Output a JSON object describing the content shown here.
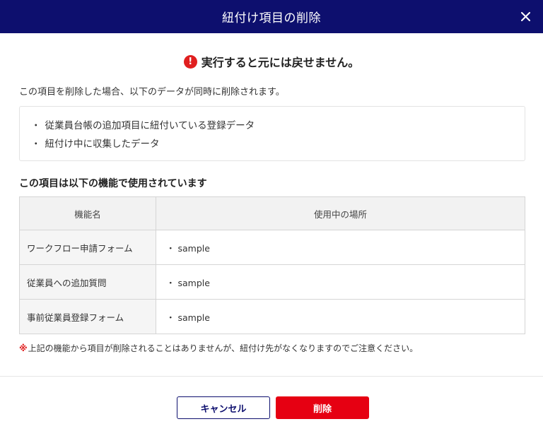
{
  "dialog": {
    "title": "紐付け項目の削除",
    "warning_icon": "!",
    "warning_text": "実行すると元には戻せません。",
    "description": "この項目を削除した場合、以下のデータが同時に削除されます。",
    "bullet": "・",
    "deleted_items": [
      "従業員台帳の追加項目に紐付いている登録データ",
      "紐付け中に収集したデータ"
    ],
    "section_title": "この項目は以下の機能で使用されています",
    "table": {
      "headers": [
        "機能名",
        "使用中の場所"
      ],
      "rows": [
        {
          "feature": "ワークフロー申請フォーム",
          "location": "・ sample"
        },
        {
          "feature": "従業員への追加質問",
          "location": "・ sample"
        },
        {
          "feature": "事前従業員登録フォーム",
          "location": "・ sample"
        }
      ]
    },
    "note_mark": "※",
    "note_text": "上記の機能から項目が削除されることはありませんが、紐付け先がなくなりますのでご注意ください。",
    "buttons": {
      "cancel": "キャンセル",
      "delete": "削除"
    }
  },
  "colors": {
    "header_bg": "#0d0f6e",
    "danger": "#e60012",
    "warning_icon": "#e01f1f"
  },
  "icons": {
    "close": "close-icon",
    "warning": "exclamation-circle-icon"
  }
}
